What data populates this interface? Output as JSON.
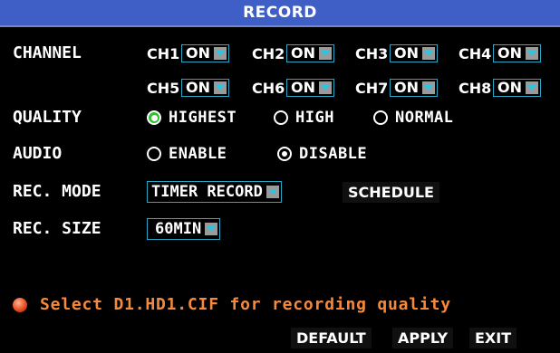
{
  "title": "RECORD",
  "labels": {
    "channel": "CHANNEL",
    "quality": "QUALITY",
    "audio": "AUDIO",
    "rec_mode": "REC. MODE",
    "rec_size": "REC. SIZE"
  },
  "channels": [
    {
      "label": "CH1",
      "value": "ON"
    },
    {
      "label": "CH2",
      "value": "ON"
    },
    {
      "label": "CH3",
      "value": "ON"
    },
    {
      "label": "CH4",
      "value": "ON"
    },
    {
      "label": "CH5",
      "value": "ON"
    },
    {
      "label": "CH6",
      "value": "ON"
    },
    {
      "label": "CH7",
      "value": "ON"
    },
    {
      "label": "CH8",
      "value": "ON"
    }
  ],
  "quality": {
    "options": [
      "HIGHEST",
      "HIGH",
      "NORMAL"
    ],
    "selected": "HIGHEST"
  },
  "audio": {
    "options": [
      "ENABLE",
      "DISABLE"
    ],
    "selected": "DISABLE"
  },
  "rec_mode": {
    "value": "TIMER RECORD",
    "schedule_label": "SCHEDULE"
  },
  "rec_size": {
    "value": "60MIN"
  },
  "hint": "Select D1.HD1.CIF for recording quality",
  "buttons": {
    "default": "DEFAULT",
    "apply": "APPLY",
    "exit": "EXIT"
  },
  "colors": {
    "title_bar": "#3f5fc6",
    "combo_border": "#29a6c6",
    "hint_text": "#f58a3c",
    "selected_radio": "#2fbf2f"
  }
}
